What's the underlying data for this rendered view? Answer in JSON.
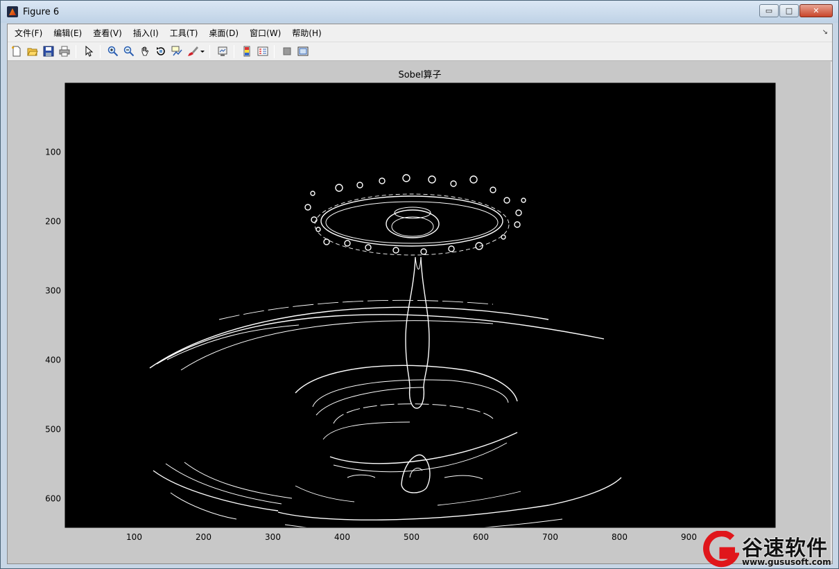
{
  "window": {
    "title": "Figure 6",
    "controls": {
      "minimize": "▭",
      "maximize": "□",
      "close": "✕"
    }
  },
  "menubar": {
    "items": [
      {
        "label": "文件(F)"
      },
      {
        "label": "编辑(E)"
      },
      {
        "label": "查看(V)"
      },
      {
        "label": "插入(I)"
      },
      {
        "label": "工具(T)"
      },
      {
        "label": "桌面(D)"
      },
      {
        "label": "窗口(W)"
      },
      {
        "label": "帮助(H)"
      }
    ]
  },
  "toolbar": {
    "icons": [
      "new-figure-icon",
      "open-file-icon",
      "save-icon",
      "print-icon",
      "edit-plot-icon",
      "zoom-in-icon",
      "zoom-out-icon",
      "pan-icon",
      "rotate-3d-icon",
      "data-cursor-icon",
      "brush-icon",
      "link-plot-icon",
      "insert-colorbar-icon",
      "insert-legend-icon",
      "hide-plot-tools-icon",
      "show-plot-tools-icon"
    ]
  },
  "plot": {
    "title": "Sobel算子",
    "xticks": [
      "100",
      "200",
      "300",
      "400",
      "500",
      "600",
      "700",
      "800",
      "900"
    ],
    "yticks": [
      "100",
      "200",
      "300",
      "400",
      "500",
      "600"
    ],
    "background": "#000000",
    "foreground": "#ffffff"
  },
  "watermark": {
    "brand": "谷速软件",
    "url": "www.gususoft.com",
    "accent": "#e0161b"
  }
}
